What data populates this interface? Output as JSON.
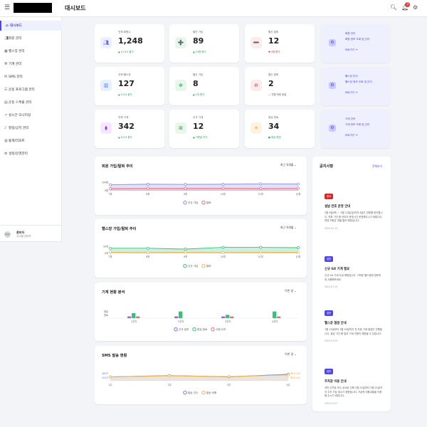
{
  "header": {
    "menu_icon": "hamburger-icon",
    "title": "대시보드",
    "notification_count": "3"
  },
  "sidebar": {
    "items": [
      {
        "label": "대시보드",
        "icon": "home-icon",
        "active": true
      },
      {
        "label": "회원 관리",
        "icon": "users-icon"
      },
      {
        "label": "헬스장 관리",
        "icon": "building-icon"
      },
      {
        "label": "기계 관리",
        "icon": "machine-icon"
      },
      {
        "label": "SMS 관리",
        "icon": "message-icon"
      },
      {
        "label": "운동 프로그램 관리",
        "icon": "program-icon"
      },
      {
        "label": "운동 스케줄 관리",
        "icon": "calendar-icon"
      },
      {
        "label": "실시간 모니터링",
        "icon": "monitor-icon"
      },
      {
        "label": "할링/공지 관리",
        "icon": "bell-icon"
      },
      {
        "label": "통계/리포트",
        "icon": "report-icon"
      },
      {
        "label": "설정/운영관리",
        "icon": "settings-icon"
      }
    ],
    "user": {
      "avatar_text": "User",
      "name": "관리자",
      "role": "시스템 관리자"
    }
  },
  "stats": [
    {
      "label": "전체 회원수",
      "value": "1,248",
      "change": "▲ 12.5% 증가",
      "trend": "up",
      "icon": "users-icon",
      "color": "#6366f1",
      "bg": "#eef0fe"
    },
    {
      "label": "월간 가입",
      "value": "89",
      "change": "▲ 23명 증가",
      "trend": "up",
      "icon": "user-plus-icon",
      "color": "#16a34a",
      "bg": "#e7f7ec"
    },
    {
      "label": "월간 탈퇴",
      "value": "12",
      "change": "▼ 3명 증가",
      "trend": "down",
      "icon": "user-minus-icon",
      "color": "#dc2626",
      "bg": "#fdecec"
    },
    {
      "label": "전체 헬스장",
      "value": "127",
      "change": "▲ 5.2% 증가",
      "trend": "up",
      "icon": "building-icon",
      "color": "#3b82f6",
      "bg": "#e8f0fe"
    },
    {
      "label": "월간 가입",
      "value": "8",
      "change": "▲ 1개 증가",
      "trend": "up",
      "icon": "plus-circle-icon",
      "color": "#16a34a",
      "bg": "#e7f7ec"
    },
    {
      "label": "월간 탈퇴",
      "value": "2",
      "change": "— 전월 대비 동일",
      "trend": "neutral",
      "icon": "minus-circle-icon",
      "color": "#dc2626",
      "bg": "#fdecec"
    },
    {
      "label": "전체 기계",
      "value": "342",
      "change": "▲ 8.2% 증가",
      "trend": "up",
      "icon": "dumbbell-icon",
      "color": "#9333ea",
      "bg": "#f3e8ff"
    },
    {
      "label": "신규 기계",
      "value": "12",
      "change": "▲ 이번달 추가",
      "trend": "up",
      "icon": "plus-square-icon",
      "color": "#16a34a",
      "bg": "#e7f7ec"
    },
    {
      "label": "점검 완료",
      "value": "34",
      "change": "● 정상 운영",
      "trend": "up",
      "icon": "wrench-icon",
      "color": "#f59e0b",
      "bg": "#fef3e2"
    }
  ],
  "promos": [
    {
      "title": "회원 관리",
      "sub": "회원 정보 조회 및 관리",
      "link": "바로가기 ➔"
    },
    {
      "title": "헬스장 관리",
      "sub": "헬스장 정보 조회 및 관리",
      "link": "바로가기 ➔"
    },
    {
      "title": "기계 관리",
      "sub": "기계 정보 조회 및 관리",
      "link": "바로가기 ➔"
    }
  ],
  "charts": {
    "member": {
      "title": "회원 가입/탈퇴 추이",
      "period": "최근 6개월"
    },
    "gym": {
      "title": "헬스장 가입/탈퇴 추이",
      "period": "최근 6개월"
    },
    "machine": {
      "title": "기계 현황 분석",
      "period": "이번 달"
    },
    "sms": {
      "title": "SMS 발송 현황",
      "period": "이번 달"
    }
  },
  "chart_data": [
    {
      "type": "area",
      "categories": [
        "7월",
        "8월",
        "9월",
        "10월",
        "11월",
        "12월"
      ],
      "series": [
        {
          "name": "신규 가입",
          "values": [
            70,
            76,
            74,
            76,
            81,
            79
          ],
          "color": "#8b8cf0"
        },
        {
          "name": "탈퇴",
          "values": [
            25,
            28,
            27,
            29,
            26,
            28
          ],
          "color": "#e8707a"
        }
      ],
      "yticks": [
        "100명",
        "0명"
      ],
      "ylim": [
        0,
        100
      ],
      "legend": "bottom"
    },
    {
      "type": "area",
      "categories": [
        "7월",
        "8월",
        "9월",
        "10월",
        "11월",
        "12월"
      ],
      "series": [
        {
          "name": "신규 가입",
          "values": [
            18,
            18,
            15,
            21,
            21,
            20
          ],
          "color": "#34c37a"
        },
        {
          "name": "탈퇴",
          "values": [
            4,
            3,
            4,
            3,
            4,
            4
          ],
          "color": "#f2b24a"
        }
      ],
      "yticks": [
        "20개",
        "0개"
      ],
      "ylim": [
        0,
        25
      ],
      "legend": "bottom"
    },
    {
      "type": "bar",
      "categories": [
        "1주차",
        "2주차",
        "3주차",
        "4주차"
      ],
      "series": [
        {
          "name": "신규 설치",
          "values": [
            1,
            1,
            1,
            0
          ],
          "color": "#a35de0"
        },
        {
          "name": "점검 완료",
          "values": [
            3,
            4,
            2,
            4
          ],
          "color": "#34c37a"
        },
        {
          "name": "고장/수리",
          "values": [
            1,
            0,
            1,
            1
          ],
          "color": "#e8707a"
        }
      ],
      "yticks": [
        "점검",
        "완료"
      ],
      "ylim": [
        0,
        6
      ],
      "legend": "bottom"
    },
    {
      "type": "line",
      "categories": [
        "1주",
        "2주",
        "3주",
        "4주"
      ],
      "series": [
        {
          "name": "발송 건수",
          "values": [
            470,
            480,
            470,
            490
          ],
          "color": "#6a86d8"
        },
        {
          "name": "발송 비용",
          "values": [
            470,
            478,
            472,
            485
          ],
          "color": "#f2b24a"
        }
      ],
      "yticks_left": [
        "480건",
        "450건"
      ],
      "yticks_right": [
        "₩50,000",
        "₩40,000"
      ],
      "ylim": [
        440,
        500
      ],
      "legend": "bottom"
    }
  ],
  "notices": {
    "title": "공지사항",
    "more": "전체보기",
    "items": [
      {
        "badge": "중요",
        "badge_color": "#dc2626",
        "title": "설날 연휴 운영 안내",
        "body": "2월 9일(목) ~ 2월 12일(일)까지 4일간 연휴를 맞이합니다. 연휴 기간 중 관리자 운영시간 운영해주시기 바랍니다. 변경 사항은 개별 통보 예정입니다.",
        "date": "2023.01.15"
      },
      {
        "badge": "일반",
        "badge_color": "#4f46e5",
        "title": "신규 GX 기계 필요",
        "body": "신규 GX 기계 도입 예정입니다. 가까운 헬스장에 방문하여 사용해보세요.",
        "date": "2023.01.10"
      },
      {
        "badge": "일반",
        "badge_color": "#4f46e5",
        "title": "헬스장 점검 안내",
        "body": "1월 15일부터 1월 20일까지 전 지점 기계 점검이 진행됩니다. 점검 기간 중 일부 기계 이용이 제한될 수 있습니다.",
        "date": "2023.01.05"
      },
      {
        "badge": "일반",
        "badge_color": "#4f46e5",
        "title": "주차장 이용 안내",
        "body": "지하 주차장 보수 공사로 인해 1월 22일부터 1월 25일까지 주차 가능 대수가 제한됩니다. 가급적 대중교통을 이용해 주시기 바랍니다.",
        "date": "2023.01.01"
      }
    ]
  }
}
